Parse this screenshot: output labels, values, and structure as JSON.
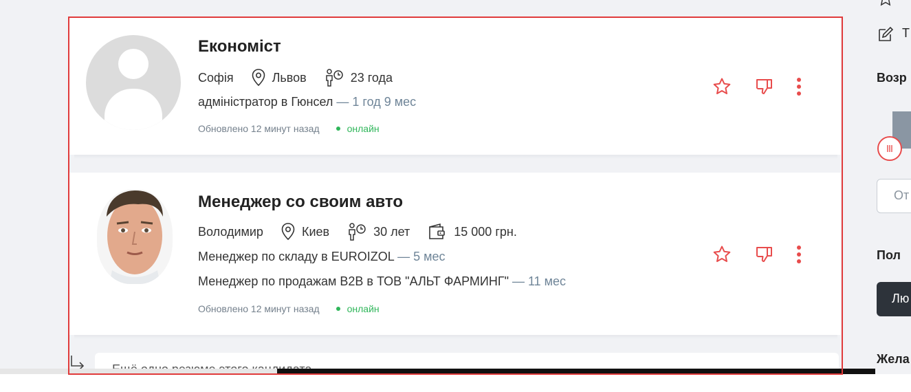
{
  "candidates": [
    {
      "title": "Економіст",
      "name": "Софія",
      "city": "Львов",
      "age": "23 года",
      "experience": [
        {
          "position": "адміністратор в Гюнсел",
          "duration": " — 1 год 9 мес"
        }
      ],
      "updated": "Обновлено 12 минут назад",
      "status": "онлайн",
      "avatar": "placeholder"
    },
    {
      "title": "Менеджер со своим авто",
      "name": "Володимир",
      "city": "Киев",
      "age": "30 лет",
      "salary": "15 000 грн.",
      "experience": [
        {
          "position": "Менеджер по складу в EUROIZOL",
          "duration": " — 5 мес"
        },
        {
          "position": "Менеджер по продажам B2B в ТОВ \"АЛЬТ ФАРМИНГ\"",
          "duration": " — 11 мес"
        }
      ],
      "updated": "Обновлено 12 минут назад",
      "status": "онлайн",
      "avatar": "photo"
    }
  ],
  "more_resume": {
    "label": "Ещё одно резюме этого кандидата"
  },
  "sidebar": {
    "item_top": "Т",
    "age_heading": "Возр",
    "from_placeholder": "От",
    "gender_heading": "Пол",
    "gender_button": "Лю",
    "wish_heading": "Жела"
  },
  "colors": {
    "accent": "#e84c4c",
    "online": "#2fb65a",
    "duration": "#6f8598"
  },
  "icons": [
    "location-icon",
    "age-icon",
    "wallet-icon",
    "star-icon",
    "dislike-icon",
    "more-icon",
    "edit-icon",
    "reply-arrow-icon"
  ]
}
